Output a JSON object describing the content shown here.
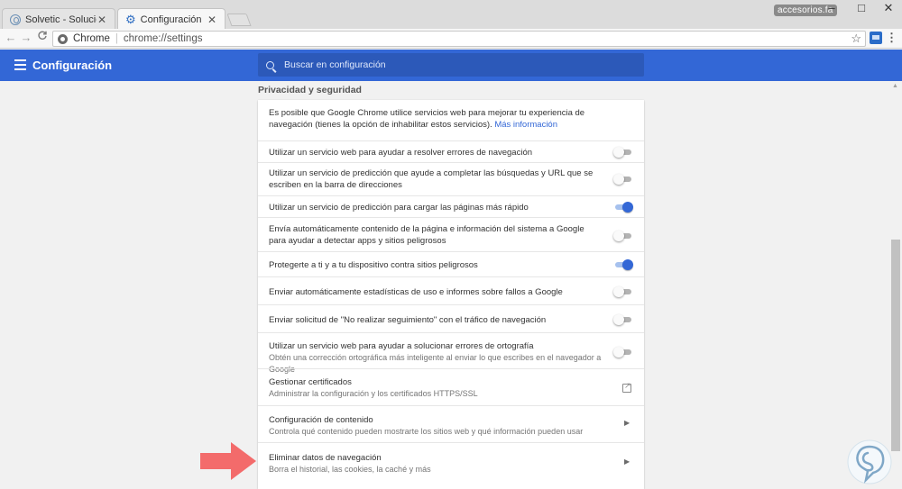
{
  "window": {
    "tabs": [
      {
        "label": "Solvetic - Solución a los p",
        "active": false
      },
      {
        "label": "Configuración",
        "active": true
      }
    ],
    "user_badge": "accesorios.fa",
    "controls": {
      "minimize": "–",
      "maximize": "□",
      "close": "✕"
    }
  },
  "toolbar": {
    "back": "←",
    "forward": "→",
    "reload": "C",
    "scheme_label": "Chrome",
    "url": "chrome://settings",
    "star": "☆",
    "menu": "⋮"
  },
  "header": {
    "title": "Configuración",
    "search_placeholder": "Buscar en configuración"
  },
  "section": {
    "title": "Privacidad y seguridad",
    "intro": "Es posible que Google Chrome utilice servicios web para mejorar tu experiencia de navegación (tienes la opción de inhabilitar estos servicios).",
    "intro_link": "Más información",
    "rows": [
      {
        "label": "Utilizar un servicio web para ayudar a resolver errores de navegación",
        "control": "toggle",
        "on": false
      },
      {
        "label": "Utilizar un servicio de predicción que ayude a completar las búsquedas y URL que se escriben en la barra de direcciones",
        "control": "toggle",
        "on": false
      },
      {
        "label": "Utilizar un servicio de predicción para cargar las páginas más rápido",
        "control": "toggle",
        "on": true
      },
      {
        "label": "Envía automáticamente contenido de la página e información del sistema a Google para ayudar a detectar apps y sitios peligrosos",
        "control": "toggle",
        "on": false
      },
      {
        "label": "Protegerte a ti y a tu dispositivo contra sitios peligrosos",
        "control": "toggle",
        "on": true
      },
      {
        "label": "Enviar automáticamente estadísticas de uso e informes sobre fallos a Google",
        "control": "toggle",
        "on": false
      },
      {
        "label": "Enviar solicitud de \"No realizar seguimiento\" con el tráfico de navegación",
        "control": "toggle",
        "on": false
      },
      {
        "label": "Utilizar un servicio web para ayudar a solucionar errores de ortografía",
        "sublabel": "Obtén una corrección ortográfica más inteligente al enviar lo que escribes en el navegador a Google",
        "control": "toggle",
        "on": false
      },
      {
        "label": "Gestionar certificados",
        "sublabel": "Administrar la configuración y los certificados HTTPS/SSL",
        "control": "external"
      },
      {
        "label": "Configuración de contenido",
        "sublabel": "Controla qué contenido pueden mostrarte los sitios web y qué información pueden usar",
        "control": "chevron"
      },
      {
        "label": "Eliminar datos de navegación",
        "sublabel": "Borra el historial, las cookies, la caché y más",
        "control": "chevron"
      }
    ]
  },
  "colors": {
    "header_blue": "#3367d6",
    "toggle_on": "#3367d6",
    "arrow": "#f36b6b"
  },
  "icons": {
    "chevron": "›"
  }
}
